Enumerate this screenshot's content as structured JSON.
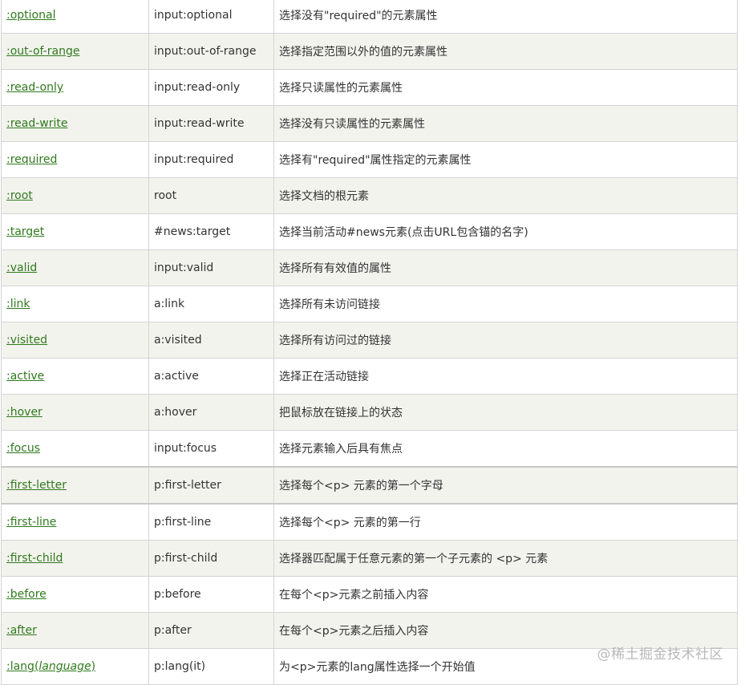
{
  "rows": [
    {
      "selector": ":optional",
      "example": "input:optional",
      "description": "选择没有\"required\"的元素属性"
    },
    {
      "selector": ":out-of-range",
      "example": "input:out-of-range",
      "description": "选择指定范围以外的值的元素属性"
    },
    {
      "selector": ":read-only",
      "example": "input:read-only",
      "description": "选择只读属性的元素属性"
    },
    {
      "selector": ":read-write",
      "example": "input:read-write",
      "description": "选择没有只读属性的元素属性"
    },
    {
      "selector": ":required",
      "example": "input:required",
      "description": "选择有\"required\"属性指定的元素属性"
    },
    {
      "selector": ":root",
      "example": "root",
      "description": "选择文档的根元素"
    },
    {
      "selector": ":target",
      "example": "#news:target",
      "description": "选择当前活动#news元素(点击URL包含锚的名字)"
    },
    {
      "selector": ":valid",
      "example": "input:valid",
      "description": "选择所有有效值的属性"
    },
    {
      "selector": ":link",
      "example": "a:link",
      "description": "选择所有未访问链接"
    },
    {
      "selector": ":visited",
      "example": "a:visited",
      "description": "选择所有访问过的链接"
    },
    {
      "selector": ":active",
      "example": "a:active",
      "description": "选择正在活动链接"
    },
    {
      "selector": ":hover",
      "example": "a:hover",
      "description": "把鼠标放在链接上的状态"
    },
    {
      "selector": ":focus",
      "example": "input:focus",
      "description": "选择元素输入后具有焦点"
    },
    {
      "selector": ":first-letter",
      "example": "p:first-letter",
      "description": "选择每个<p> 元素的第一个字母"
    },
    {
      "selector": ":first-line",
      "example": "p:first-line",
      "description": "选择每个<p> 元素的第一行"
    },
    {
      "selector": ":first-child",
      "example": "p:first-child",
      "description": "选择器匹配属于任意元素的第一个子元素的 <p> 元素"
    },
    {
      "selector": ":before",
      "example": "p:before",
      "description": "在每个<p>元素之前插入内容"
    },
    {
      "selector": ":after",
      "example": "p:after",
      "description": "在每个<p>元素之后插入内容"
    },
    {
      "selector": ":lang(",
      "selector_italic": "language",
      "selector_suffix": ")",
      "example": "p:lang(it)",
      "description": "为<p>元素的lang属性选择一个开始值"
    }
  ],
  "watermark": "@稀土掘金技术社区",
  "colors": {
    "link": "#2f7a1d",
    "stripe": "#f3f3ee",
    "border": "#d4d4d4"
  }
}
